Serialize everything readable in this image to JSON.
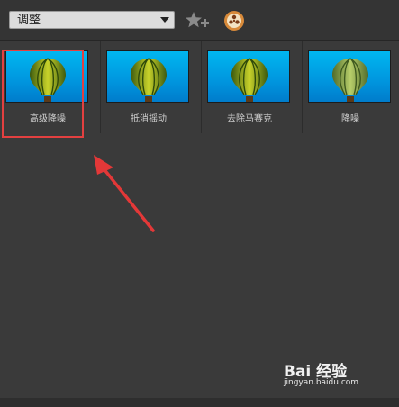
{
  "toolbar": {
    "dropdown_value": "调整",
    "favorite_icon": "star-plus-icon",
    "effect_icon": "aperture-icon"
  },
  "presets": [
    {
      "label": "高级降噪",
      "icon": "balloon-thumbnail"
    },
    {
      "label": "抵消摇动",
      "icon": "balloon-thumbnail"
    },
    {
      "label": "去除马赛克",
      "icon": "balloon-thumbnail"
    },
    {
      "label": "降噪",
      "icon": "balloon-thumbnail"
    }
  ],
  "colors": {
    "panel_bg": "#3a3a3a",
    "thumb_sky": "#00a8ec",
    "selection": "#e34040"
  },
  "watermark": {
    "brand": "Bai 经验",
    "url": "jingyan.baidu.com"
  }
}
